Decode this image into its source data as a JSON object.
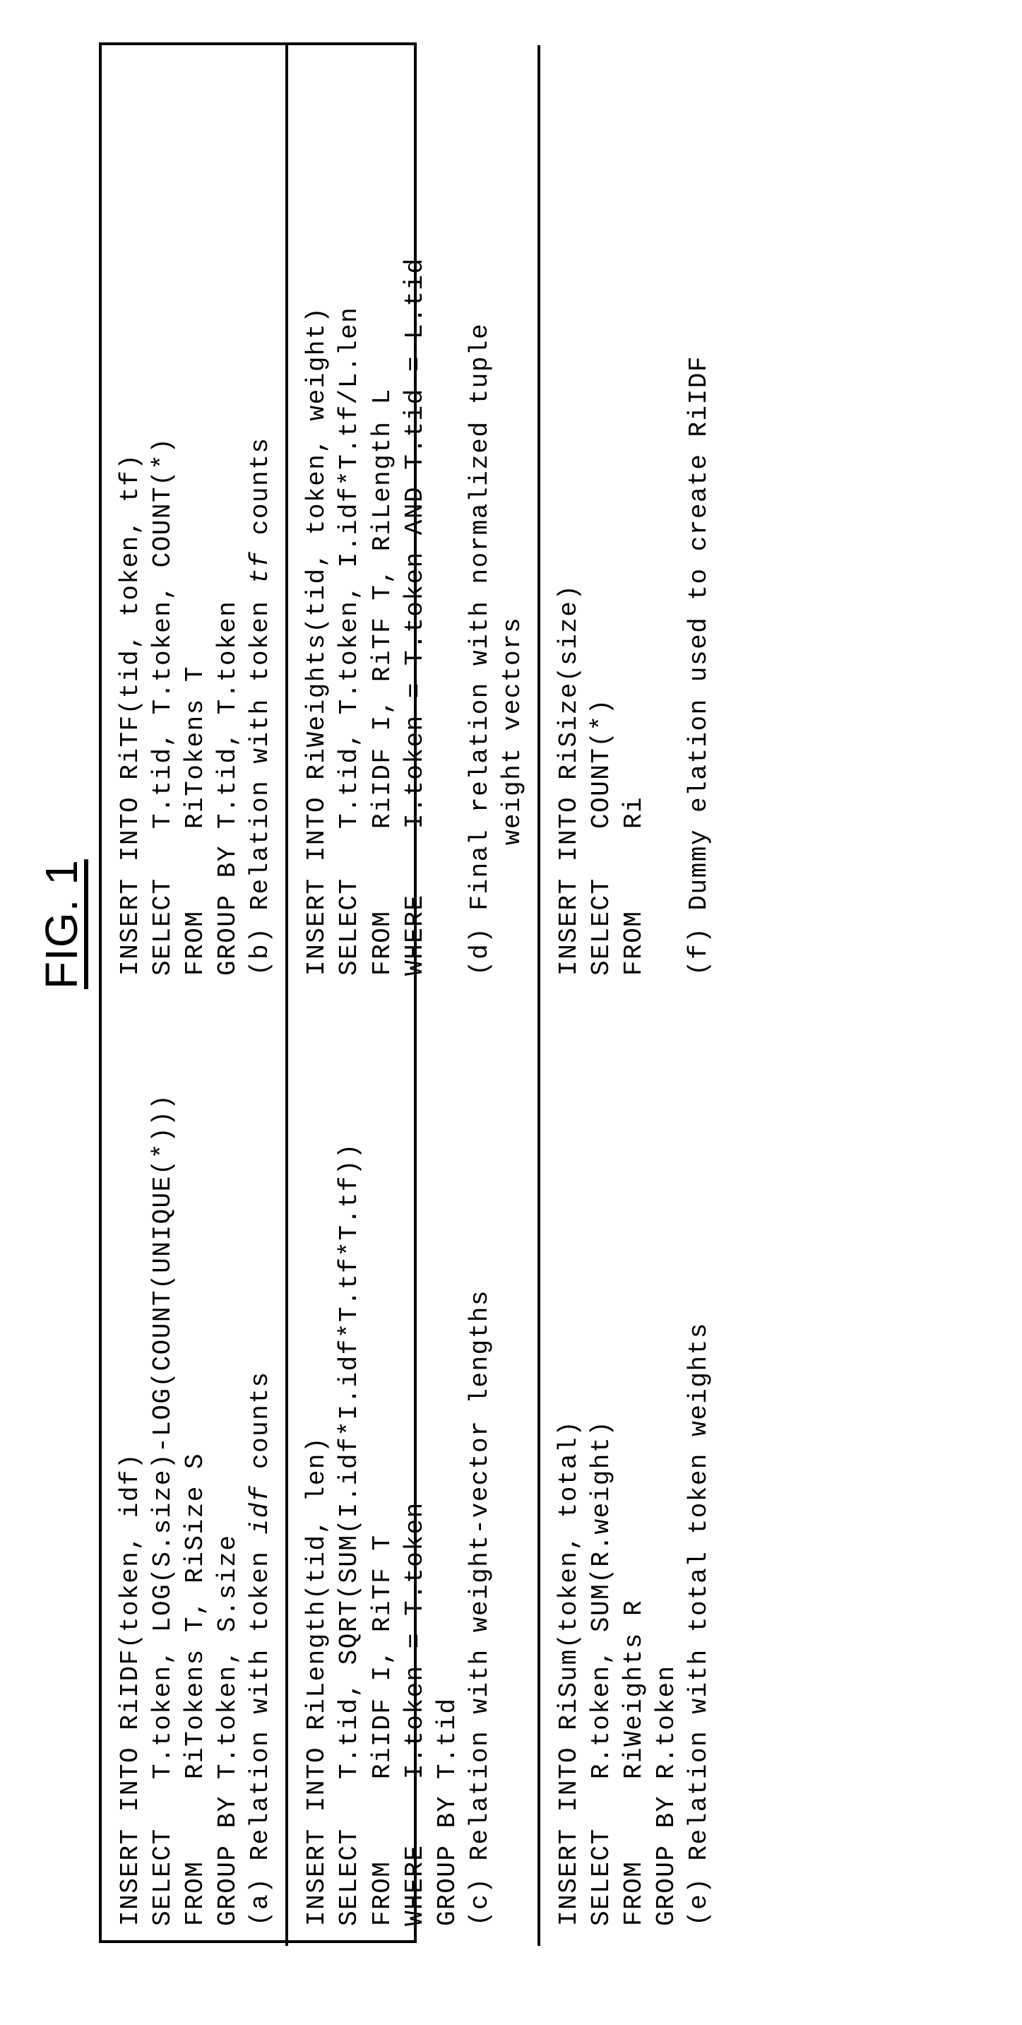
{
  "figure_label": "FIG. 1",
  "blocks": {
    "a": {
      "l1": "INSERT INTO RiIDF(token, idf)",
      "l2": "SELECT   T.token, LOG(S.size)-LOG(COUNT(UNIQUE(*)))",
      "l3": "FROM     RiTokens T, RiSize S",
      "l4": "GROUP BY T.token, S.size",
      "l5_pre": "(a) Relation with token ",
      "l5_it": "idf",
      "l5_post": " counts"
    },
    "b": {
      "l1": "INSERT INTO RiTF(tid, token, tf)",
      "l2": "SELECT   T.tid, T.token, COUNT(*)",
      "l3": "FROM     RiTokens T",
      "l4": "GROUP BY T.tid, T.token",
      "l5_pre": "(b) Relation with token ",
      "l5_it": "tf",
      "l5_post": " counts"
    },
    "c": {
      "l1": "INSERT INTO RiLength(tid, len)",
      "l2": "SELECT   T.tid, SQRT(SUM(I.idf*I.idf*T.tf*T.tf))",
      "l3": "FROM     RiIDF I, RiTF T",
      "l4": "WHERE    I.token = T.token",
      "l5": "GROUP BY T.tid",
      "l6": "(c) Relation with weight-vector lengths"
    },
    "d": {
      "l1": "INSERT INTO RiWeights(tid, token, weight)",
      "l2": "SELECT   T.tid, T.token, I.idf*T.tf/L.len",
      "l3": "FROM     RiIDF I, RiTF T, RiLength L",
      "l4": "WHERE    I.token = T.token AND T.tid = L.tid",
      "l5": "(d) Final relation with normalized tuple",
      "l6": "        weight vectors"
    },
    "e": {
      "l1": "INSERT INTO RiSum(token, total)",
      "l2": "SELECT   R.token, SUM(R.weight)",
      "l3": "FROM     RiWeights R",
      "l4": "GROUP BY R.token",
      "l5": "(e) Relation with total token weights"
    },
    "f": {
      "l1": "INSERT INTO RiSize(size)",
      "l2": "SELECT   COUNT(*)",
      "l3": "FROM     Ri",
      "l4": " ",
      "l5": "(f) Dummy elation used to create RiIDF"
    }
  }
}
